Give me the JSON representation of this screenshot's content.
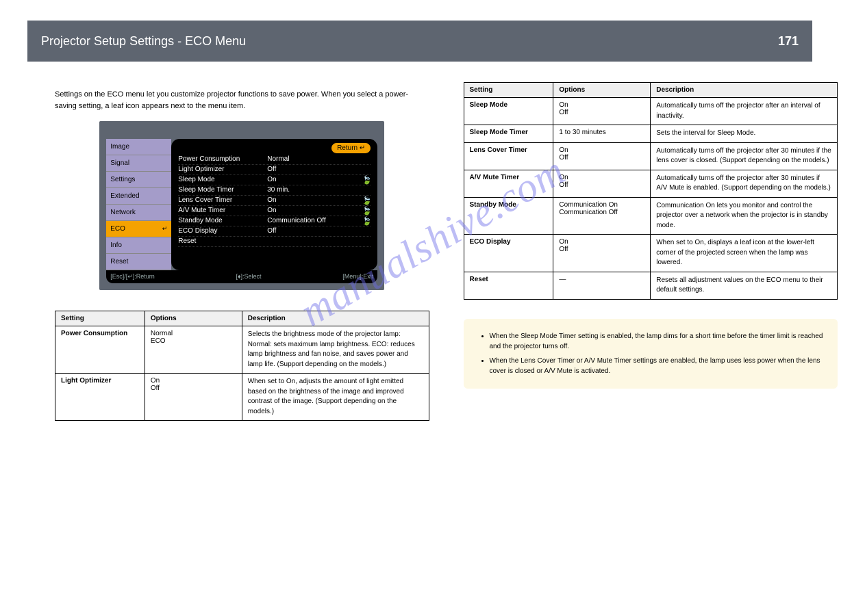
{
  "header": {
    "title": "Projector Setup Settings - ECO Menu",
    "page_number": "171"
  },
  "intro": "Settings on the ECO menu let you customize projector functions to save power. When you select a power-saving setting, a leaf icon appears next to the menu item.",
  "osd": {
    "tabs": [
      "Image",
      "Signal",
      "Settings",
      "Extended",
      "Network",
      "ECO",
      "Info",
      "Reset"
    ],
    "selected_tab": "ECO",
    "return_label": "Return ↵",
    "rows": [
      {
        "k": "Power Consumption",
        "v": "Normal",
        "leaf": false
      },
      {
        "k": "Light Optimizer",
        "v": "Off",
        "leaf": false
      },
      {
        "k": "Sleep Mode",
        "v": "On",
        "leaf": true
      },
      {
        "k": "Sleep Mode Timer",
        "v": "30 min.",
        "leaf": false
      },
      {
        "k": "Lens Cover Timer",
        "v": "On",
        "leaf": true
      },
      {
        "k": "A/V Mute Timer",
        "v": "On",
        "leaf": true
      },
      {
        "k": "Standby Mode",
        "v": "Communication Off",
        "leaf": true
      },
      {
        "k": "ECO Display",
        "v": "Off",
        "leaf": false
      },
      {
        "k": "Reset",
        "v": "",
        "leaf": false
      }
    ],
    "footer_left": "[Esc]/[↵]:Return",
    "footer_center": "[♦]:Select",
    "footer_right": "[Menu]:Exit"
  },
  "table1": {
    "headers": [
      "Setting",
      "Options",
      "Description"
    ],
    "rows": [
      {
        "setting": "Power Consumption",
        "options": "Normal\nECO",
        "description": "Selects the brightness mode of the projector lamp: Normal: sets maximum lamp brightness. ECO: reduces lamp brightness and fan noise, and saves power and lamp life. (Support depending on the models.)"
      },
      {
        "setting": "Light Optimizer",
        "options": "On\nOff",
        "description": "When set to On, adjusts the amount of light emitted based on the brightness of the image and improved contrast of the image. (Support depending on the models.)"
      }
    ]
  },
  "table2": {
    "headers": [
      "Setting",
      "Options",
      "Description"
    ],
    "rows": [
      {
        "setting": "Sleep Mode",
        "options": "On\nOff",
        "description": "Automatically turns off the projector after an interval of inactivity."
      },
      {
        "setting": "Sleep Mode Timer",
        "options": "1 to 30 minutes",
        "description": "Sets the interval for Sleep Mode."
      },
      {
        "setting": "Lens Cover Timer",
        "options": "On\nOff",
        "description": "Automatically turns off the projector after 30 minutes if the lens cover is closed. (Support depending on the models.)"
      },
      {
        "setting": "A/V Mute Timer",
        "options": "On\nOff",
        "description": "Automatically turns off the projector after 30 minutes if A/V Mute is enabled. (Support depending on the models.)"
      },
      {
        "setting": "Standby Mode",
        "options": "Communication On\nCommunication Off",
        "description": "Communication On lets you monitor and control the projector over a network when the projector is in standby mode."
      },
      {
        "setting": "ECO Display",
        "options": "On\nOff",
        "description": "When set to On, displays a leaf icon at the lower-left corner of the projected screen when the lamp was lowered."
      },
      {
        "setting": "Reset",
        "options": "—",
        "description": "Resets all adjustment values on the ECO menu to their default settings."
      }
    ]
  },
  "note": {
    "bullets": [
      "When the Sleep Mode Timer setting is enabled, the lamp dims for a short time before the timer limit is reached and the projector turns off.",
      "When the Lens Cover Timer or A/V Mute Timer settings are enabled, the lamp uses less power when the lens cover is closed or A/V Mute is activated."
    ]
  },
  "watermark": "manualshive.com"
}
